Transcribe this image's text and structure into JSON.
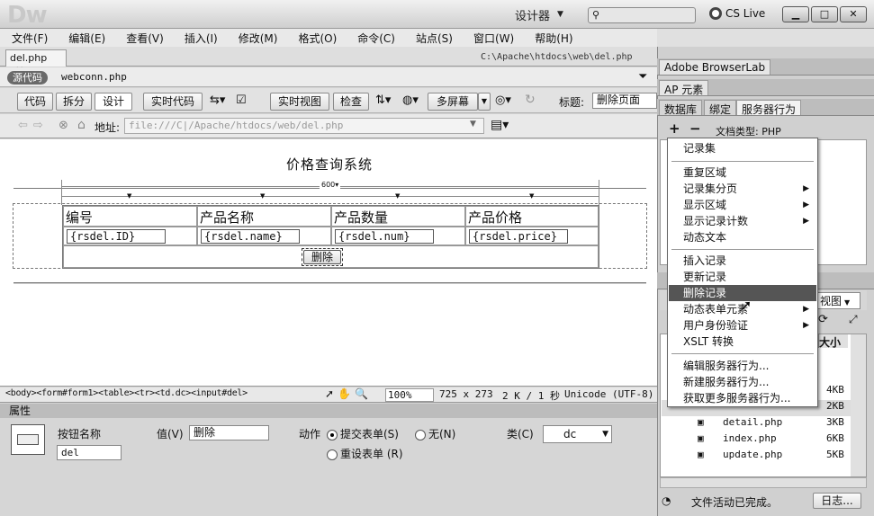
{
  "app": {
    "logo": "Dw",
    "workspace": "设计器",
    "workspace_arrow": "▼",
    "cslive": "CS Live",
    "win_min": "▁",
    "win_max": "□",
    "win_close": "✕"
  },
  "menu": [
    "文件(F)",
    "编辑(E)",
    "查看(V)",
    "插入(I)",
    "修改(M)",
    "格式(O)",
    "命令(C)",
    "站点(S)",
    "窗口(W)",
    "帮助(H)"
  ],
  "document": {
    "tab": "del.php",
    "close": "×",
    "path": "C:\\Apache\\htdocs\\web\\del.php",
    "source_btn": "源代码",
    "related_file": "webconn.php"
  },
  "toolbar": {
    "code": "代码",
    "split": "拆分",
    "design": "设计",
    "live_code": "实时代码",
    "live_view": "实时视图",
    "inspect": "检查",
    "multiscreen": "多屏幕",
    "title_label": "标题:",
    "title_value": "删除页面"
  },
  "address": {
    "label": "地址:",
    "value": "file:///C|/Apache/htdocs/web/del.php"
  },
  "page": {
    "heading": "价格查询系统",
    "table_width": "600",
    "headers": [
      "编号",
      "产品名称",
      "产品数量",
      "产品价格"
    ],
    "fields": [
      "{rsdel.ID}",
      "{rsdel.name}",
      "{rsdel.num}",
      "{rsdel.price}"
    ],
    "delete_btn": "删除"
  },
  "status": {
    "tags": "<body><form#form1><table><tr><td.dc><input#del>",
    "zoom": "100%",
    "size": "725 x 273",
    "filesize": "2 K / 1 秒",
    "encoding": "Unicode (UTF-8)"
  },
  "properties": {
    "header": "属性",
    "btn_name_label": "按钮名称",
    "btn_name": "del",
    "value_label": "值(V)",
    "value": "删除",
    "action_label": "动作",
    "submit": "提交表单(S)",
    "none": "无(N)",
    "reset": "重设表单 (R)",
    "class_label": "类(C)",
    "class_value": "dc"
  },
  "right": {
    "browserlab": "Adobe BrowserLab",
    "ap": "AP 元素",
    "tabs": [
      "数据库",
      "绑定",
      "服务器行为"
    ],
    "plus": "+",
    "minus": "−",
    "doctype": "文档类型: PHP",
    "view": "视图",
    "size_hdr": "大小",
    "files": [
      {
        "name": "",
        "size": "4KB"
      },
      {
        "name": "",
        "size": "2KB"
      },
      {
        "name": "detail.php",
        "size": "3KB"
      },
      {
        "name": "index.php",
        "size": "6KB"
      },
      {
        "name": "update.php",
        "size": "5KB"
      }
    ],
    "activity": "文件活动已完成。",
    "log": "日志..."
  },
  "context_menu": {
    "items": [
      "记录集",
      "重复区域",
      "记录集分页",
      "显示区域",
      "显示记录计数",
      "动态文本",
      "插入记录",
      "更新记录",
      "删除记录",
      "动态表单元素",
      "用户身份验证",
      "XSLT 转换",
      "编辑服务器行为...",
      "新建服务器行为...",
      "获取更多服务器行为..."
    ]
  },
  "colors": {
    "highlight": "#555555",
    "panel": "#d0d0d0"
  }
}
